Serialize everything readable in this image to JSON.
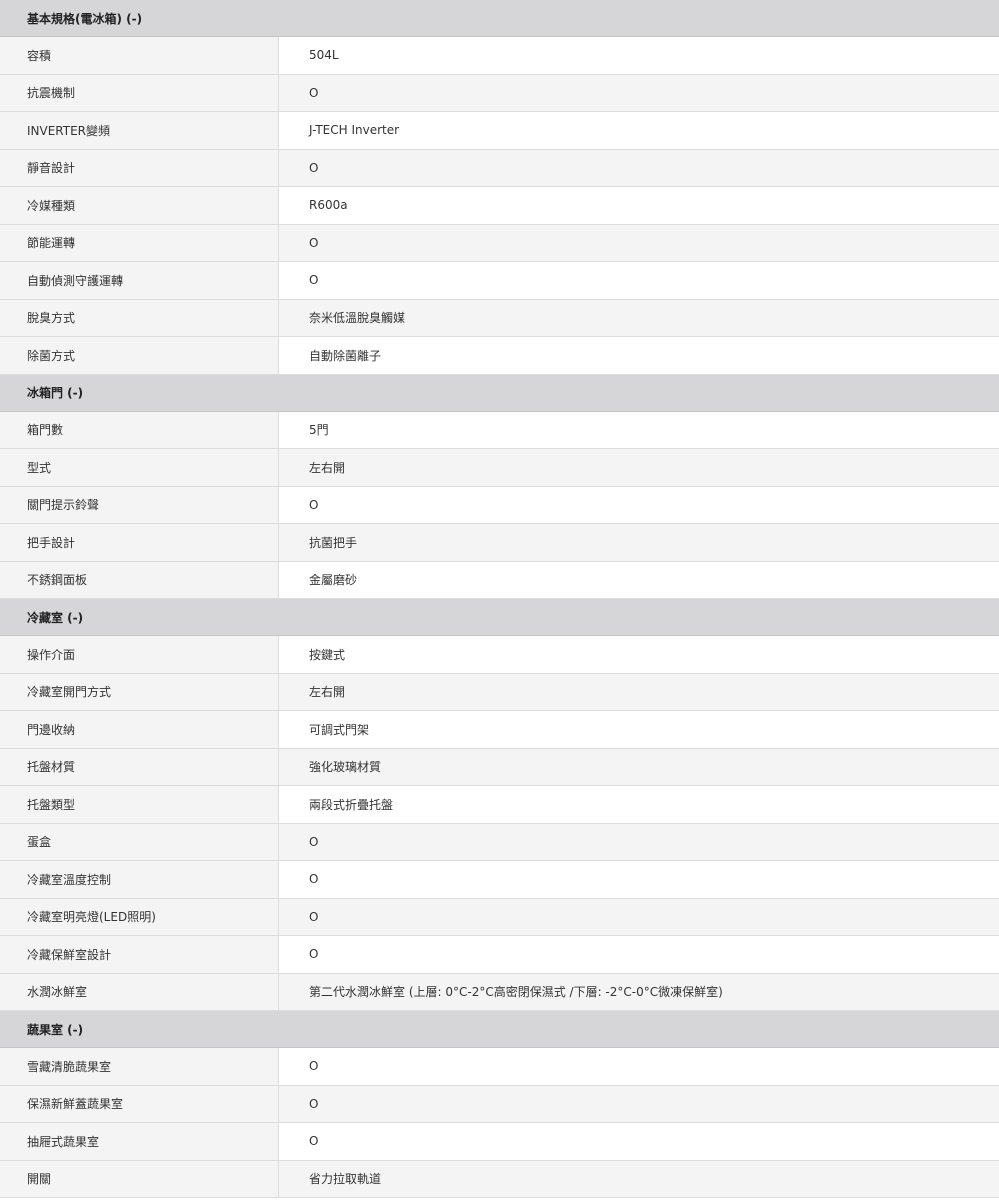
{
  "sections": [
    {
      "title": "基本規格(電冰箱) (-)",
      "rows": [
        {
          "label": "容積",
          "value": "504L"
        },
        {
          "label": "抗震機制",
          "value": "O"
        },
        {
          "label": "INVERTER變頻",
          "value": "J-TECH Inverter"
        },
        {
          "label": "靜音設計",
          "value": "O"
        },
        {
          "label": "冷媒種類",
          "value": "R600a"
        },
        {
          "label": "節能運轉",
          "value": "O"
        },
        {
          "label": "自動偵測守護運轉",
          "value": "O"
        },
        {
          "label": "脫臭方式",
          "value": "奈米低溫脫臭觸媒"
        },
        {
          "label": "除菌方式",
          "value": "自動除菌離子"
        }
      ]
    },
    {
      "title": "冰箱門 (-)",
      "rows": [
        {
          "label": "箱門數",
          "value": "5門"
        },
        {
          "label": "型式",
          "value": "左右開"
        },
        {
          "label": "關門提示鈴聲",
          "value": "O"
        },
        {
          "label": "把手設計",
          "value": "抗菌把手"
        },
        {
          "label": "不銹鋼面板",
          "value": "金屬磨砂"
        }
      ]
    },
    {
      "title": "冷藏室 (-)",
      "rows": [
        {
          "label": "操作介面",
          "value": "按鍵式"
        },
        {
          "label": "冷藏室開門方式",
          "value": "左右開"
        },
        {
          "label": "門邊收納",
          "value": "可調式門架"
        },
        {
          "label": "托盤材質",
          "value": "強化玻璃材質"
        },
        {
          "label": "托盤類型",
          "value": "兩段式折疊托盤"
        },
        {
          "label": "蛋盒",
          "value": "O"
        },
        {
          "label": "冷藏室溫度控制",
          "value": "O"
        },
        {
          "label": "冷藏室明亮燈(LED照明)",
          "value": "O"
        },
        {
          "label": "冷藏保鮮室設計",
          "value": "O"
        },
        {
          "label": "水潤冰鮮室",
          "value": "第二代水潤冰鮮室 (上層: 0°C-2°C高密閉保濕式 /下層: -2°C-0°C微凍保鮮室)"
        }
      ]
    },
    {
      "title": "蔬果室 (-)",
      "rows": [
        {
          "label": "雪藏清脆蔬果室",
          "value": "O"
        },
        {
          "label": "保濕新鮮蓋蔬果室",
          "value": "O"
        },
        {
          "label": "抽屜式蔬果室",
          "value": "O"
        },
        {
          "label": "開關",
          "value": "省力拉取軌道"
        }
      ]
    }
  ]
}
